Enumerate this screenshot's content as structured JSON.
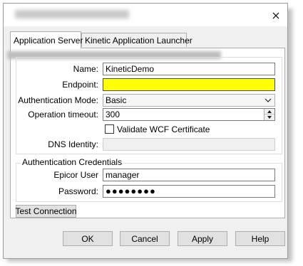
{
  "dialog": {
    "close_icon": "close-icon"
  },
  "tabs": [
    {
      "label": "Application Server"
    },
    {
      "label": "Kinetic Application Launcher"
    }
  ],
  "form": {
    "name_label": "Name:",
    "name_value": "KineticDemo",
    "endpoint_label": "Endpoint:",
    "endpoint_value": "",
    "auth_mode_label": "Authentication Mode:",
    "auth_mode_value": "Basic",
    "timeout_label": "Operation timeout:",
    "timeout_value": "300",
    "validate_wcf_label": "Validate WCF Certificate",
    "validate_wcf_checked": false,
    "dns_label": "DNS Identity:",
    "dns_value": ""
  },
  "credentials": {
    "legend": "Authentication Credentials",
    "user_label": "Epicor User",
    "user_value": "manager",
    "password_label": "Password:",
    "password_mask": "●●●●●●●●"
  },
  "test_connection_label": "Test Connection",
  "buttons": {
    "ok": "OK",
    "cancel": "Cancel",
    "apply": "Apply",
    "help": "Help"
  },
  "colors": {
    "endpoint_highlight": "#ffff00",
    "dialog_bg": "#f0f0f0"
  }
}
